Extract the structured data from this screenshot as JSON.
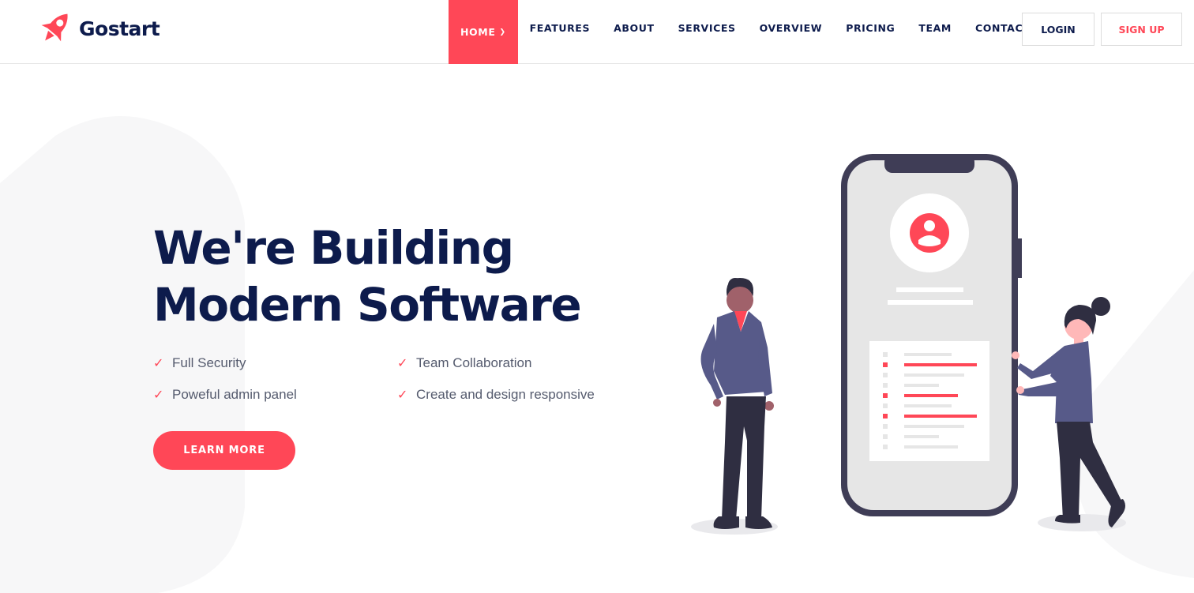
{
  "brand": {
    "name": "Gostart",
    "logo_icon": "rocket-icon",
    "accent": "#ff4757",
    "dark": "#0d1b4c"
  },
  "nav": {
    "items": [
      {
        "label": "HOME",
        "active": true,
        "has_dropdown": true
      },
      {
        "label": "FEATURES"
      },
      {
        "label": "ABOUT"
      },
      {
        "label": "SERVICES"
      },
      {
        "label": "OVERVIEW"
      },
      {
        "label": "PRICING"
      },
      {
        "label": "TEAM"
      },
      {
        "label": "CONTACT"
      }
    ],
    "login_label": "LOGIN",
    "signup_label": "SIGN UP"
  },
  "hero": {
    "title_line1": "We're Building",
    "title_line2": "Modern Software",
    "features": [
      "Full Security",
      "Team Collaboration",
      "Poweful admin panel",
      "Create and design responsive"
    ],
    "cta_label": "LEARN MORE"
  }
}
